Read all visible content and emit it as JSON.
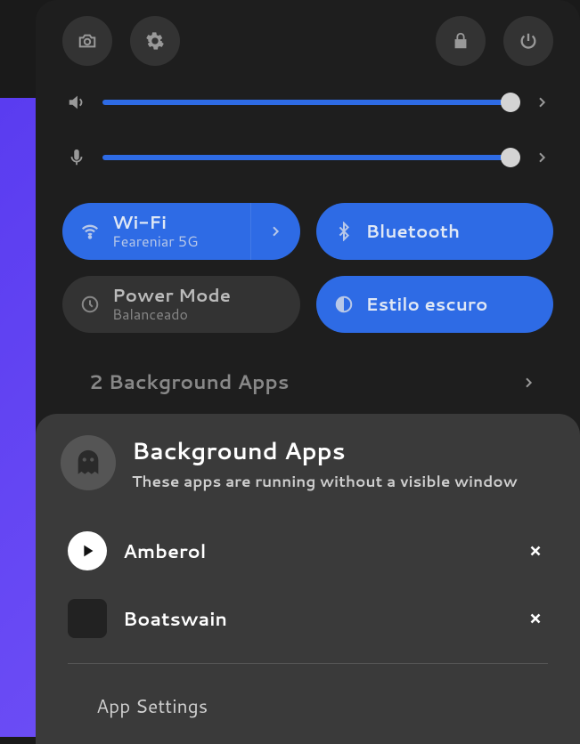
{
  "sliders": {
    "volume": 98,
    "mic": 98
  },
  "toggles": {
    "wifi": {
      "title": "Wi-Fi",
      "subtitle": "Feareniar 5G"
    },
    "bluetooth": {
      "title": "Bluetooth"
    },
    "power": {
      "title": "Power Mode",
      "subtitle": "Balanceado"
    },
    "dark": {
      "title": "Estilo escuro"
    }
  },
  "bg_apps": {
    "summary": "2 Background Apps",
    "popup_title": "Background Apps",
    "popup_subtitle": "These apps are running without a visible window",
    "apps": [
      {
        "name": "Amberol"
      },
      {
        "name": "Boatswain"
      }
    ],
    "settings_link": "App Settings"
  }
}
